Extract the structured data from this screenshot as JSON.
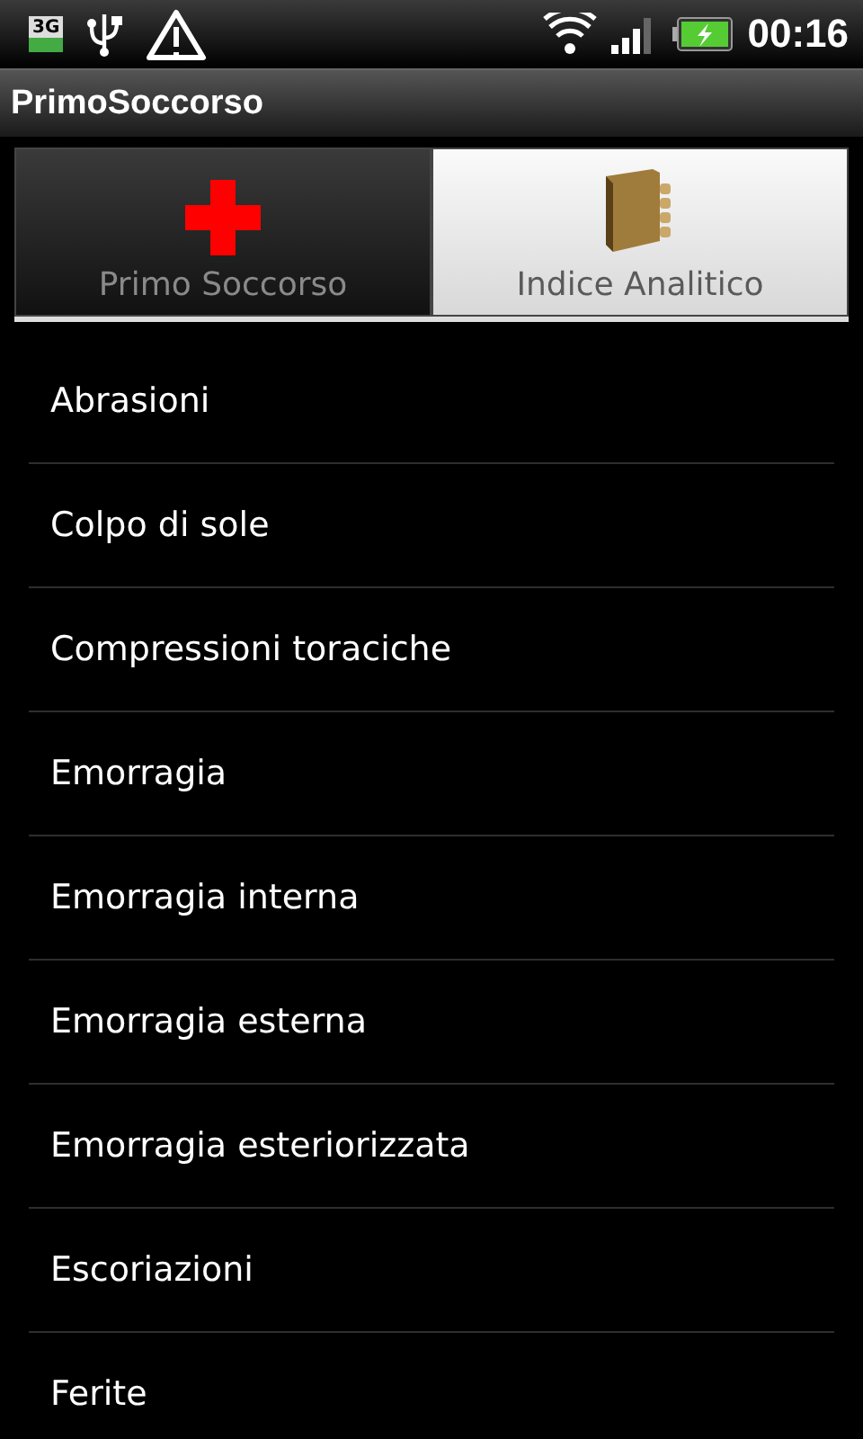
{
  "status_bar": {
    "network": "3G",
    "time": "00:16"
  },
  "window": {
    "title": "PrimoSoccorso"
  },
  "tabs": [
    {
      "label": "Primo Soccorso",
      "kind": "cross",
      "selected": false
    },
    {
      "label": "Indice Analitico",
      "kind": "book",
      "selected": true
    }
  ],
  "items": [
    "Abrasioni",
    "Colpo di sole",
    "Compressioni toraciche",
    "Emorragia",
    "Emorragia interna",
    "Emorragia esterna",
    "Emorragia esteriorizzata",
    "Escoriazioni",
    "Ferite"
  ]
}
